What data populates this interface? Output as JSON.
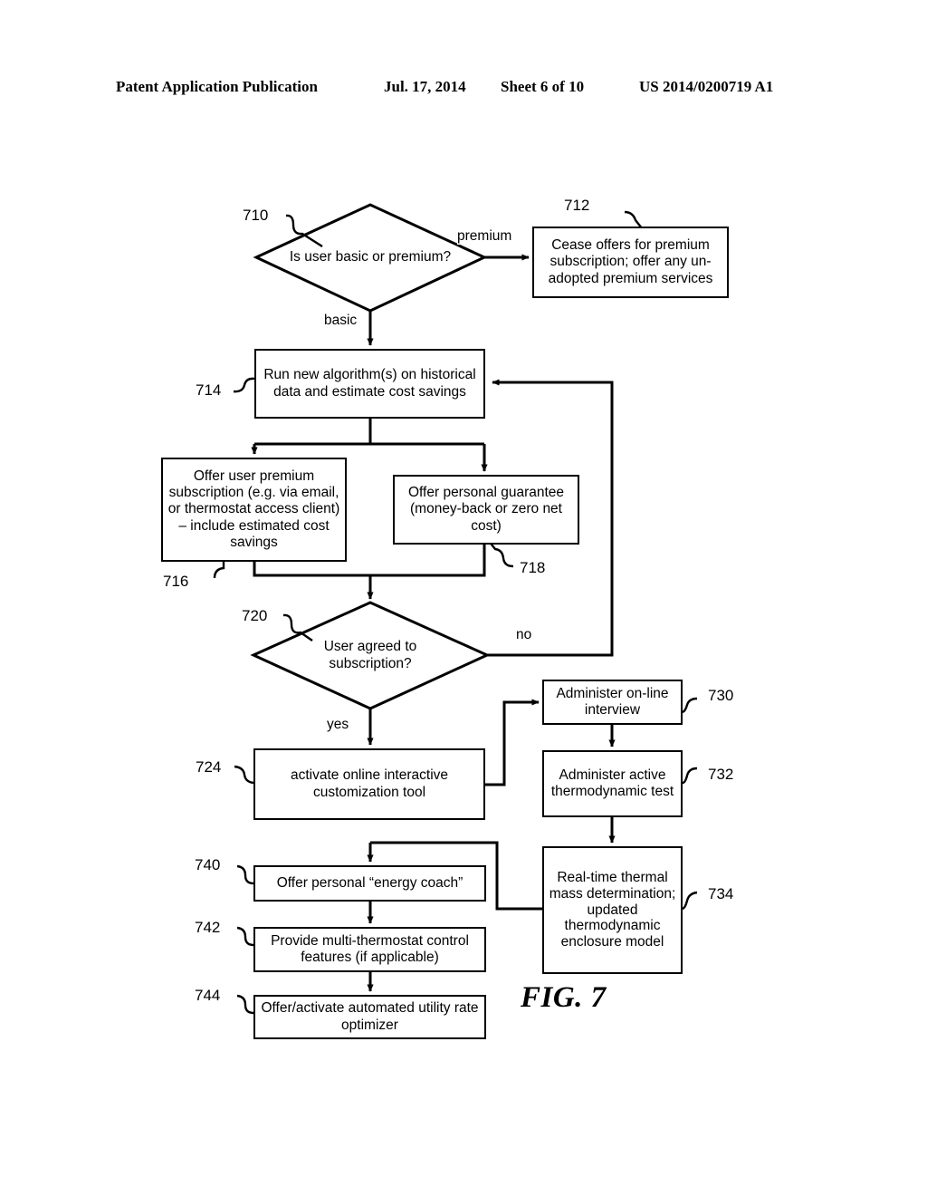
{
  "header": {
    "publication": "Patent Application Publication",
    "date": "Jul. 17, 2014",
    "sheet": "Sheet 6 of 10",
    "number": "US 2014/0200719 A1"
  },
  "figure": {
    "label": "FIG. 7",
    "nodes": [
      {
        "id": "710",
        "ref": "710",
        "shape": "diamond",
        "text": "Is user basic or premium?"
      },
      {
        "id": "712",
        "ref": "712",
        "shape": "process",
        "text": "Cease offers for premium subscription; offer any un-adopted premium services"
      },
      {
        "id": "714",
        "ref": "714",
        "shape": "process",
        "text": "Run new algorithm(s) on historical data and estimate cost savings"
      },
      {
        "id": "716",
        "ref": "716",
        "shape": "process",
        "text": "Offer user premium subscription (e.g. via email, or thermostat access client) – include estimated cost savings"
      },
      {
        "id": "718",
        "ref": "718",
        "shape": "process",
        "text": "Offer personal guarantee (money-back or zero net cost)"
      },
      {
        "id": "720",
        "ref": "720",
        "shape": "diamond",
        "text": "User agreed to subscription?"
      },
      {
        "id": "724",
        "ref": "724",
        "shape": "process",
        "text": "activate online interactive customization tool"
      },
      {
        "id": "730",
        "ref": "730",
        "shape": "process",
        "text": "Administer on-line interview"
      },
      {
        "id": "732",
        "ref": "732",
        "shape": "process",
        "text": "Administer active thermodynamic test"
      },
      {
        "id": "734",
        "ref": "734",
        "shape": "process",
        "text": "Real-time thermal mass determination; updated thermodynamic enclosure model"
      },
      {
        "id": "740",
        "ref": "740",
        "shape": "process",
        "text": "Offer personal “energy coach”"
      },
      {
        "id": "742",
        "ref": "742",
        "shape": "process",
        "text": "Provide multi-thermostat control features (if applicable)"
      },
      {
        "id": "744",
        "ref": "744",
        "shape": "process",
        "text": "Offer/activate automated utility rate optimizer"
      }
    ],
    "edge_labels": {
      "premium": "premium",
      "basic": "basic",
      "no": "no",
      "yes": "yes"
    }
  }
}
